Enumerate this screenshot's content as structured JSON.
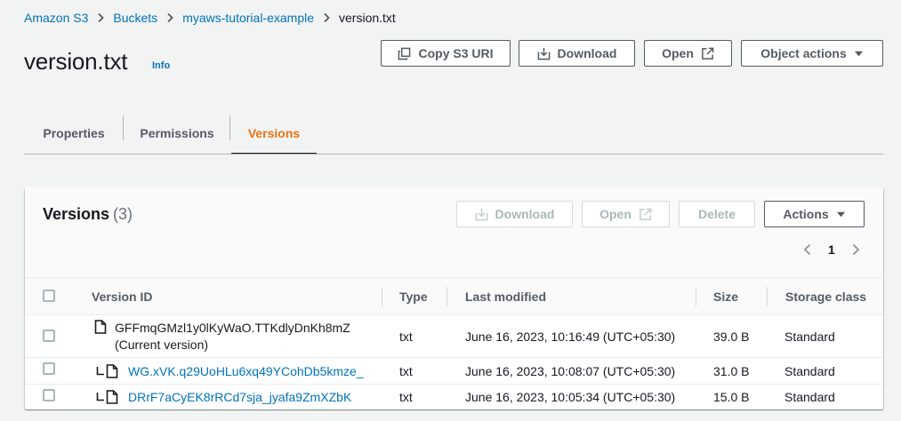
{
  "breadcrumb": {
    "items": [
      "Amazon S3",
      "Buckets",
      "myaws-tutorial-example"
    ],
    "current": "version.txt"
  },
  "header": {
    "title": "version.txt",
    "info": "Info",
    "buttons": {
      "copy_uri": "Copy S3 URI",
      "download": "Download",
      "open": "Open",
      "object_actions": "Object actions"
    }
  },
  "tabs": [
    "Properties",
    "Permissions",
    "Versions"
  ],
  "active_tab": "Versions",
  "versions_panel": {
    "title": "Versions",
    "count": "(3)",
    "buttons": {
      "download": "Download",
      "open": "Open",
      "delete": "Delete",
      "actions": "Actions"
    },
    "page": "1",
    "columns": [
      "Version ID",
      "Type",
      "Last modified",
      "Size",
      "Storage class"
    ],
    "rows": [
      {
        "version_id": "GFFmqGMzl1y0lKyWaO.TTKdlyDnKh8mZ",
        "current_label": "(Current version)",
        "type": "txt",
        "last_modified": "June 16, 2023, 10:16:49 (UTC+05:30)",
        "size": "39.0 B",
        "storage_class": "Standard"
      },
      {
        "version_id": "WG.xVK.q29UoHLu6xq49YCohDb5kmze_",
        "type": "txt",
        "last_modified": "June 16, 2023, 10:08:07 (UTC+05:30)",
        "size": "31.0 B",
        "storage_class": "Standard"
      },
      {
        "version_id": "DRrF7aCyEK8rRCd7sja_jyafa9ZmXZbK",
        "type": "txt",
        "last_modified": "June 16, 2023, 10:05:34 (UTC+05:30)",
        "size": "15.0 B",
        "storage_class": "Standard"
      }
    ]
  },
  "colors": {
    "link": "#0073bb",
    "active_tab": "#ec7211",
    "text": "#16191f",
    "muted": "#545b64",
    "disabled": "#aab7b8"
  }
}
